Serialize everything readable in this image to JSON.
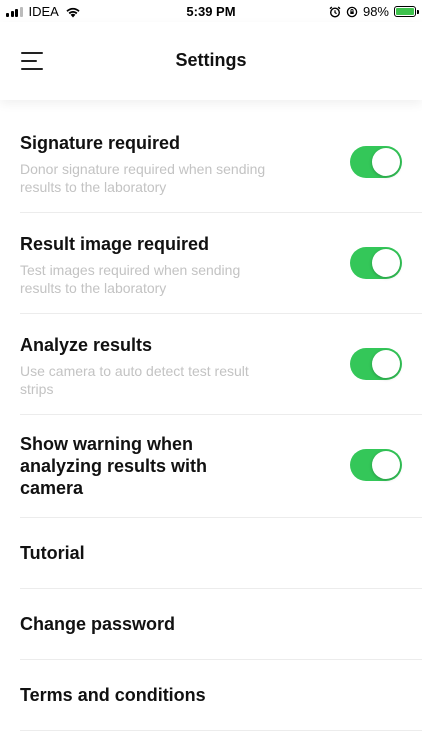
{
  "status_bar": {
    "carrier": "IDEA",
    "time": "5:39 PM",
    "battery": "98%",
    "battery_level": 0.98,
    "battery_color": "#3ec24d"
  },
  "header": {
    "title": "Settings",
    "menu_icon": "hamburger-menu-icon"
  },
  "settings": {
    "toggles": [
      {
        "title": "Signature required",
        "description": "Donor signature required when sending results to the laboratory",
        "enabled": true
      },
      {
        "title": "Result image required",
        "description": "Test images required when sending results to the laboratory",
        "enabled": true
      },
      {
        "title": "Analyze results",
        "description": "Use camera to auto detect test result strips",
        "enabled": true
      },
      {
        "title": "Show warning when analyzing results with camera",
        "description": "",
        "enabled": true
      }
    ],
    "links": [
      {
        "label": "Tutorial"
      },
      {
        "label": "Change password"
      },
      {
        "label": "Terms and conditions"
      }
    ]
  },
  "colors": {
    "toggle_on": "#34c759",
    "description_text": "#c3c3c3",
    "divider": "#ececec"
  }
}
